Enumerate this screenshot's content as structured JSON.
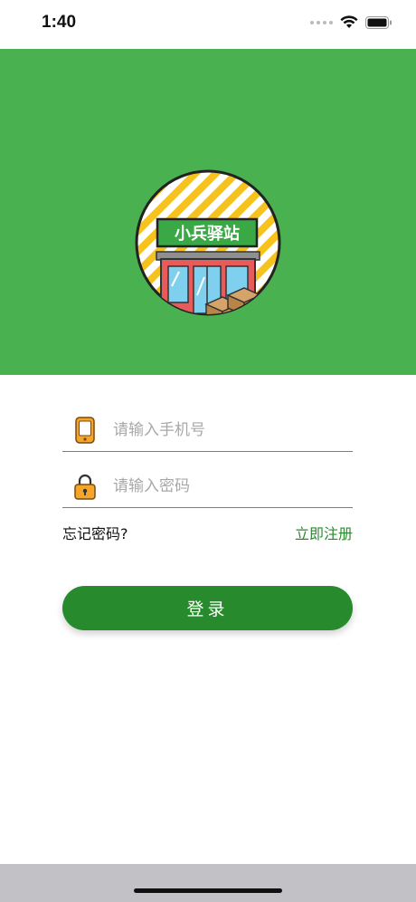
{
  "status_bar": {
    "time": "1:40"
  },
  "logo": {
    "sign_text": "小兵驿站"
  },
  "form": {
    "phone": {
      "placeholder": "请输入手机号",
      "value": "",
      "icon": "phone-icon"
    },
    "password": {
      "placeholder": "请输入密码",
      "value": "",
      "icon": "lock-icon"
    }
  },
  "links": {
    "forgot_password": "忘记密码?",
    "register": "立即注册"
  },
  "login_button": {
    "label": "登录"
  },
  "colors": {
    "hero_background": "#49b150",
    "button": "#278a2c",
    "register_link": "#2a8a2e",
    "icon_accent": "#f4a62a"
  }
}
